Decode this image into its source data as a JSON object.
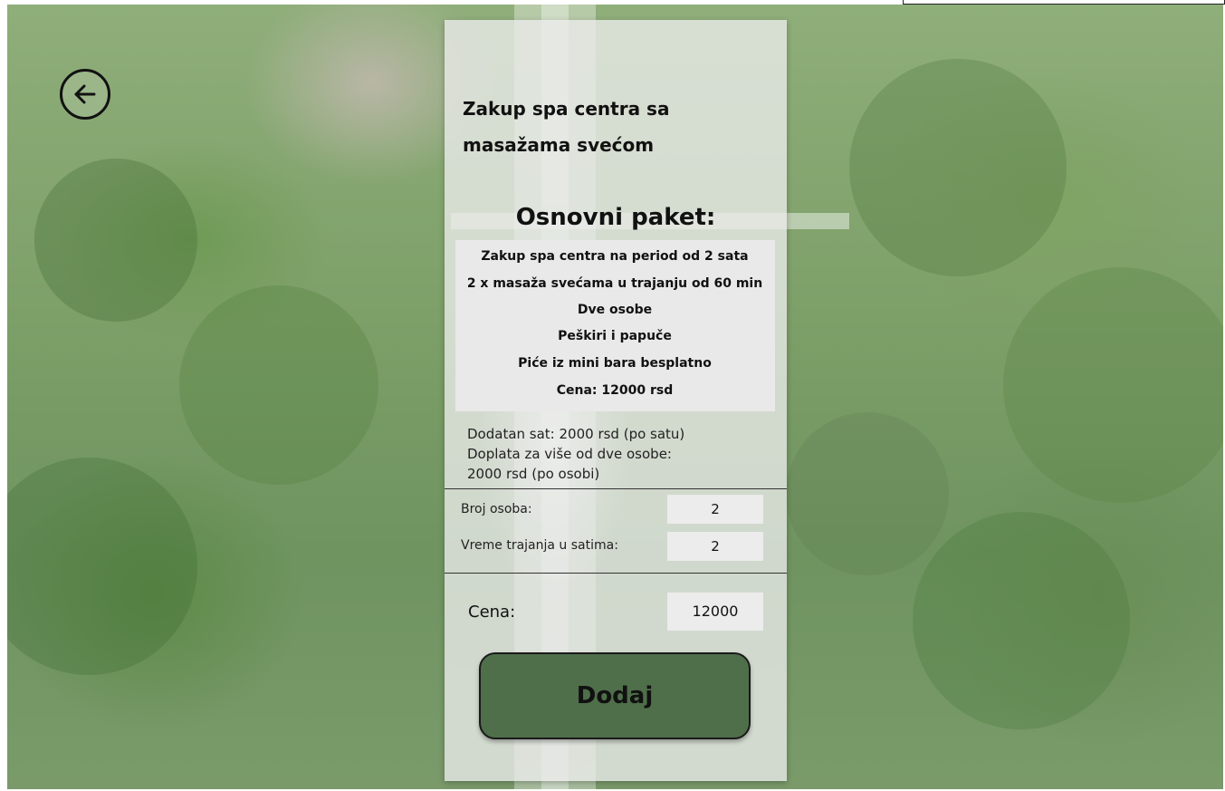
{
  "header": {
    "title_line1": "Zakup spa centra sa",
    "title_line2": "masažama svećom"
  },
  "package": {
    "heading": "Osnovni paket:",
    "lines": [
      "Zakup spa centra na period od 2 sata",
      "2 x masaža svećama u trajanju od 60 min",
      "Dve osobe",
      "Peškiri i papuče",
      "Piće iz mini bara besplatno",
      "Cena: 12000 rsd"
    ]
  },
  "extras": {
    "line1": "Dodatan sat: 2000 rsd (po satu)",
    "line2": "Doplata za više od dve osobe:",
    "line3": "2000 rsd (po osobi)"
  },
  "form": {
    "persons_label": "Broj osoba:",
    "persons_value": "2",
    "hours_label": "Vreme trajanja u satima:",
    "hours_value": "2"
  },
  "price": {
    "label": "Cena:",
    "value": "12000"
  },
  "actions": {
    "add_label": "Dodaj",
    "back_icon": "arrow-left-icon"
  }
}
